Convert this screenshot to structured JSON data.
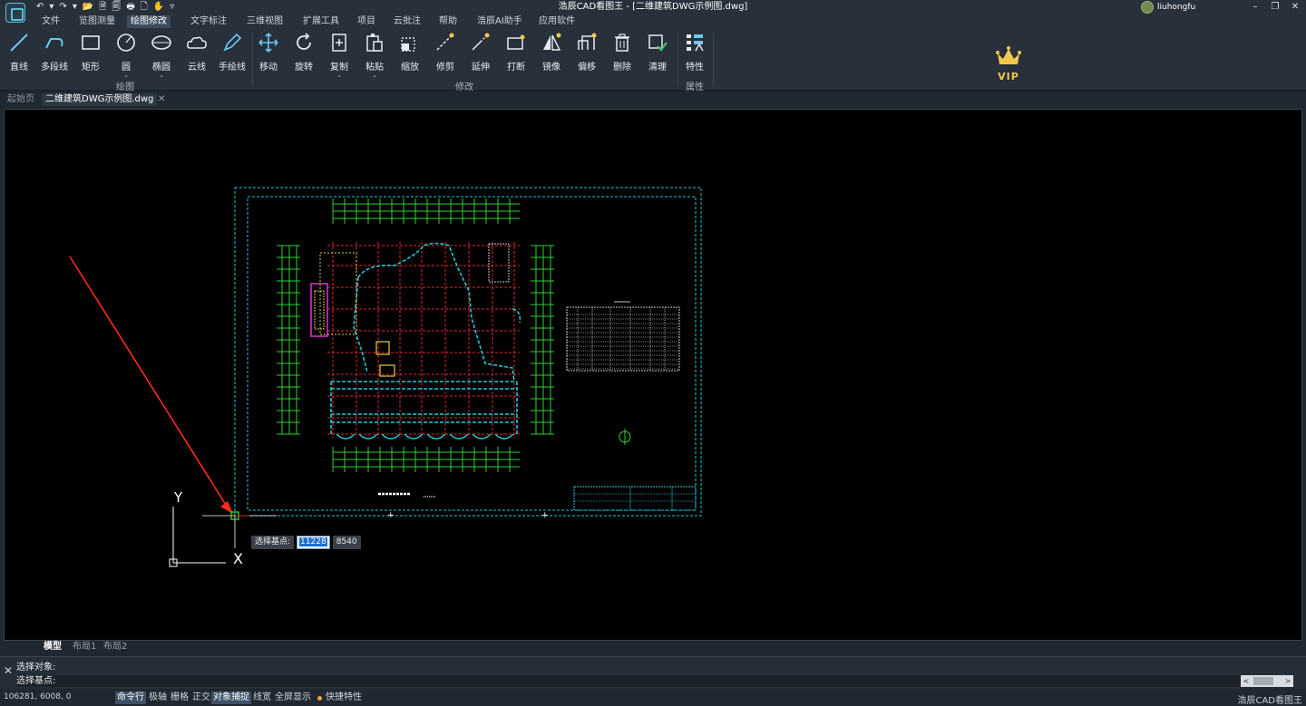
{
  "titlebar": {
    "title": "浩辰CAD看图王 - [二维建筑DWG示例图.dwg]",
    "quick_access": [
      "↶",
      "▾",
      "↷",
      "▾",
      "📂",
      "🗎",
      "🗐",
      "🖶",
      "🗋",
      "✋",
      "▿"
    ],
    "user_name": "liuhongfu",
    "controls": {
      "minimize": "–",
      "restore": "❐",
      "close": "✕"
    }
  },
  "menu": {
    "items": [
      "文件",
      "览图测量",
      "绘图修改",
      "文字标注",
      "三维视图",
      "扩展工具",
      "项目",
      "云批注",
      "帮助",
      "浩辰AI助手",
      "应用软件"
    ],
    "active": "绘图修改"
  },
  "ribbon": {
    "draw_tools": [
      "直线",
      "多段线",
      "矩形",
      "圆",
      "椭圆",
      "云线",
      "手绘线"
    ],
    "draw_group_label": "绘图",
    "modify_tools": [
      "移动",
      "旋转",
      "复制",
      "粘贴",
      "缩放",
      "修剪",
      "延伸",
      "打断",
      "镜像",
      "偏移",
      "删除",
      "清理"
    ],
    "modify_group_label": "修改",
    "property_tools": [
      "特性"
    ],
    "property_group_label": "属性",
    "caret": "⌄",
    "vip_label": "VIP",
    "colors": {
      "accent": "#57c1d6",
      "vip": "#f2c94c"
    }
  },
  "doc_tabs": {
    "home": "起始页",
    "file": "二维建筑DWG示例图.dwg",
    "close": "✕"
  },
  "canvas": {
    "base_point_prompt": "选择基点:",
    "coord_x": "11228",
    "coord_y": "8540",
    "ucs_x_label": "X",
    "ucs_y_label": "Y",
    "colors": {
      "background": "#000000",
      "frame": "#22c7d6",
      "grid": "#e0262b",
      "dims": "#2fd12f",
      "walls": "#22c7d6",
      "arrow": "#ff2a1a"
    }
  },
  "layout_tabs": {
    "model": "模型",
    "layout1": "布局1",
    "layout2": "布局2"
  },
  "command": {
    "line1": "选择对象:",
    "line2": "选择基点:",
    "close": "✕",
    "scroll_left": "<",
    "scroll_right": ">"
  },
  "status": {
    "coords": "106281, 6008, 0",
    "buttons": [
      {
        "label": "命令行",
        "on": true
      },
      {
        "label": "极轴",
        "on": false
      },
      {
        "label": "栅格",
        "on": false
      },
      {
        "label": "正交",
        "on": false
      },
      {
        "label": "对象捕捉",
        "on": true
      },
      {
        "label": "线宽",
        "on": false
      },
      {
        "label": "全屏显示",
        "on": false
      },
      {
        "label": "快捷特性",
        "on": false
      }
    ],
    "app_name": "浩辰CAD看图王"
  }
}
